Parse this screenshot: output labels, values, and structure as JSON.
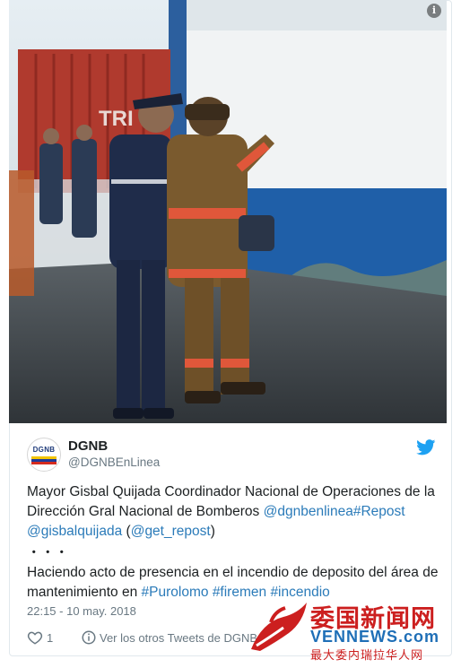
{
  "photo": {
    "info_glyph": "i",
    "container_text": "TRI"
  },
  "author": {
    "avatar_text": "DGNB",
    "name": "DGNB",
    "handle": "@DGNBEnLinea"
  },
  "tweet": {
    "line1_text": "Mayor Gisbal Quijada Coordinador Nacional de Operaciones de la Dirección Gral Nacional de Bomberos ",
    "mention1": "@dgnbenlinea",
    "hashtag1": "#Repost",
    "mention2": "@gisbalquijada",
    "paren_open": " (",
    "mention3": "@get_repost",
    "paren_close": ")",
    "dots": "・・・",
    "line2_text": "Haciendo acto de presencia en el incendio de deposito del área de mantenimiento en ",
    "hashtag2": "#Purolomo",
    "hashtag3": "#firemen",
    "hashtag4": "#incendio"
  },
  "timestamp": "22:15 - 10 may. 2018",
  "actions": {
    "like_count": "1",
    "more_tweets_label": "Ver los otros Tweets de DGNB"
  },
  "watermark": {
    "chinese": "委国新闻网",
    "english": "VENNEWS.com",
    "subtitle": "最大委内瑞拉华人网"
  },
  "colors": {
    "link": "#2b7bb9",
    "twitter_blue": "#1da1f2",
    "muted": "#697882",
    "watermark_red": "#cc1f1f"
  },
  "icons": [
    "info-icon",
    "twitter-bird-icon",
    "heart-icon",
    "info-circle-icon"
  ]
}
